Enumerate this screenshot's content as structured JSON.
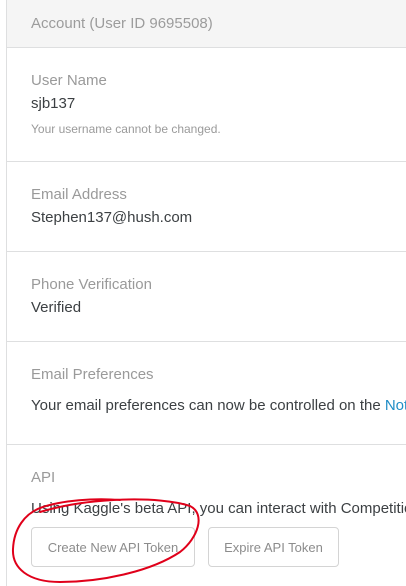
{
  "account": {
    "header_title": "Account (User ID 9695508)"
  },
  "username": {
    "label": "User Name",
    "value": "sjb137",
    "hint": "Your username cannot be changed."
  },
  "email": {
    "label": "Email Address",
    "value": "Stephen137@hush.com"
  },
  "phone": {
    "label": "Phone Verification",
    "value": "Verified"
  },
  "preferences": {
    "label": "Email Preferences",
    "text": "Your email preferences can now be controlled on the ",
    "link_text": "Not"
  },
  "api": {
    "label": "API",
    "description": "Using Kaggle's beta API, you can interact with Competitio",
    "create_button": "Create New API Token",
    "expire_button": "Expire API Token"
  },
  "colors": {
    "annotation_stroke": "#e0001a",
    "link": "#1f8dc6",
    "divider": "#dedfe0"
  }
}
